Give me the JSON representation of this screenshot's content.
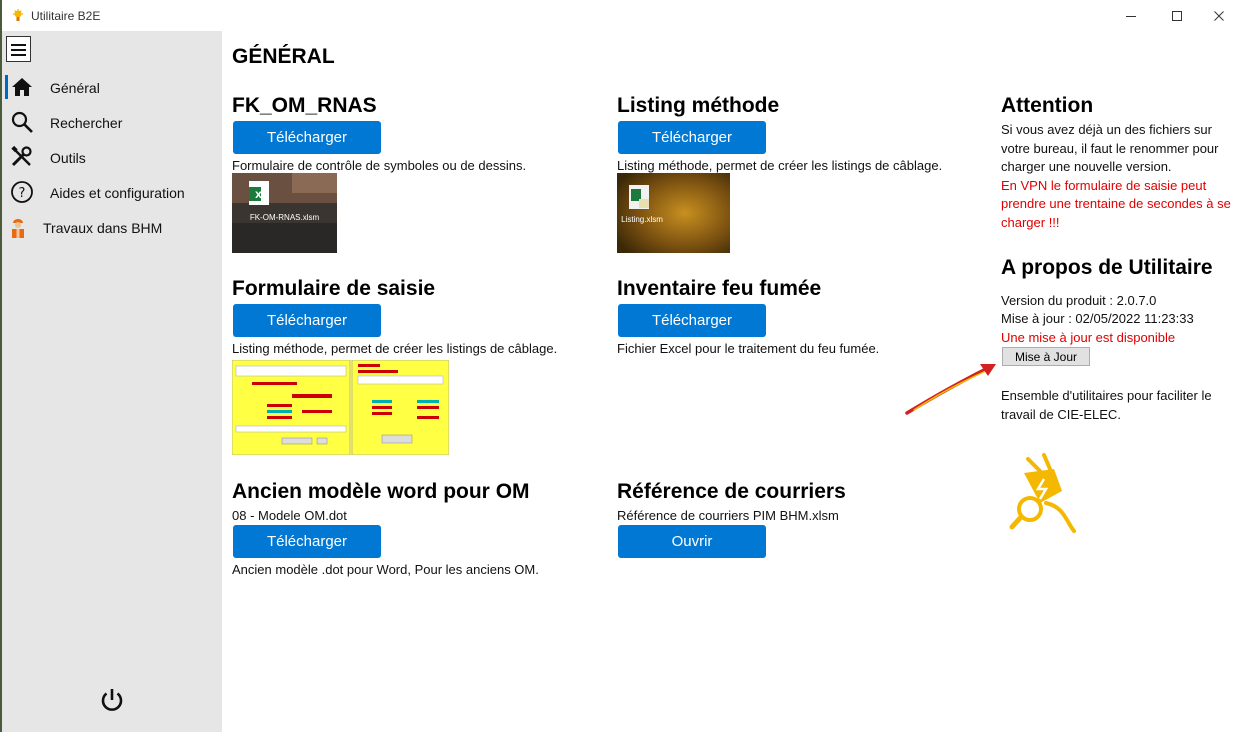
{
  "window": {
    "title": "Utilitaire B2E",
    "controls": {
      "minimize": "—",
      "maximize": "☐",
      "close": "✕"
    }
  },
  "sidebar": {
    "items": [
      {
        "label": "Général",
        "icon": "home-icon",
        "selected": true
      },
      {
        "label": "Rechercher",
        "icon": "search-icon"
      },
      {
        "label": "Outils",
        "icon": "tools-icon"
      },
      {
        "label": "Aides et configuration",
        "icon": "help-icon"
      },
      {
        "label": "Travaux dans BHM",
        "icon": "worker-icon"
      }
    ]
  },
  "main": {
    "page_title": "GÉNÉRAL",
    "sections": [
      {
        "title": "FK_OM_RNAS",
        "button": "Télécharger",
        "description": "Formulaire de contrôle de symboles ou de dessins.",
        "thumb_label": "FK-OM-RNAS.xlsm"
      },
      {
        "title": "Listing méthode",
        "button": "Télécharger",
        "description": "Listing méthode, permet de créer les listings de câblage.",
        "thumb_label": "Listing.xlsm"
      },
      {
        "title": "Formulaire de saisie",
        "button": "Télécharger",
        "description": "Listing méthode, permet de créer les listings de câblage."
      },
      {
        "title": "Inventaire feu fumée",
        "button": "Télécharger",
        "description": "Fichier Excel pour le traitement du feu fumée."
      },
      {
        "title": "Ancien modèle word pour OM",
        "subtitle": "08 - Modele OM.dot",
        "button": "Télécharger",
        "description": "Ancien modèle .dot pour Word, Pour les anciens OM."
      },
      {
        "title": "Référence de courriers",
        "subtitle": "Référence de courriers PIM BHM.xlsm",
        "button": "Ouvrir"
      }
    ],
    "attention": {
      "title": "Attention",
      "text": "Si vous avez déjà un des fichiers sur votre bureau, il faut le renommer pour charger une nouvelle version.",
      "warning": "En VPN le formulaire de saisie peut prendre une trentaine de secondes à se charger !!!"
    },
    "about": {
      "title": "A propos de Utilitaire",
      "version": "Version du produit : 2.0.7.0",
      "update_date": "Mise à jour : 02/05/2022 11:23:33",
      "update_available": "Une mise à jour est disponible",
      "update_button": "Mise à Jour",
      "description": "Ensemble d'utilitaires pour faciliter le travail de CIE-ELEC."
    }
  },
  "colors": {
    "accent": "#0078d4",
    "warning": "#e00000",
    "sidebar_bg": "#e6e6e6",
    "logo": "#f5b800"
  }
}
